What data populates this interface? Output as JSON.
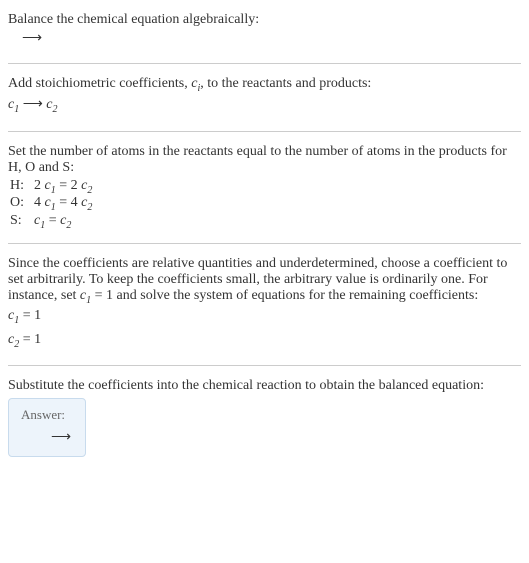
{
  "section1": {
    "title": "Balance the chemical equation algebraically:",
    "arrow": "⟶"
  },
  "section2": {
    "title_part1": "Add stoichiometric coefficients, ",
    "title_ci": "c",
    "title_ci_sub": "i",
    "title_part2": ", to the reactants and products:",
    "expr_c1": "c",
    "expr_c1_sub": "1",
    "expr_arrow": " ⟶ ",
    "expr_c2": "c",
    "expr_c2_sub": "2"
  },
  "section3": {
    "title": "Set the number of atoms in the reactants equal to the number of atoms in the products for H, O and S:",
    "rows": [
      {
        "label": "H:",
        "lhs_coef": "2 ",
        "lhs_var": "c",
        "lhs_sub": "1",
        "eq": " = ",
        "rhs_coef": "2 ",
        "rhs_var": "c",
        "rhs_sub": "2"
      },
      {
        "label": "O:",
        "lhs_coef": "4 ",
        "lhs_var": "c",
        "lhs_sub": "1",
        "eq": " = ",
        "rhs_coef": "4 ",
        "rhs_var": "c",
        "rhs_sub": "2"
      },
      {
        "label": "S:",
        "lhs_coef": "",
        "lhs_var": "c",
        "lhs_sub": "1",
        "eq": " = ",
        "rhs_coef": "",
        "rhs_var": "c",
        "rhs_sub": "2"
      }
    ]
  },
  "section4": {
    "title_part1": "Since the coefficients are relative quantities and underdetermined, choose a coefficient to set arbitrarily. To keep the coefficients small, the arbitrary value is ordinarily one. For instance, set ",
    "title_c1": "c",
    "title_c1_sub": "1",
    "title_part2": " = 1 and solve the system of equations for the remaining coefficients:",
    "line1_var": "c",
    "line1_sub": "1",
    "line1_rest": " = 1",
    "line2_var": "c",
    "line2_sub": "2",
    "line2_rest": " = 1"
  },
  "section5": {
    "title": "Substitute the coefficients into the chemical reaction to obtain the balanced equation:"
  },
  "answer": {
    "label": "Answer:",
    "arrow": "⟶"
  }
}
